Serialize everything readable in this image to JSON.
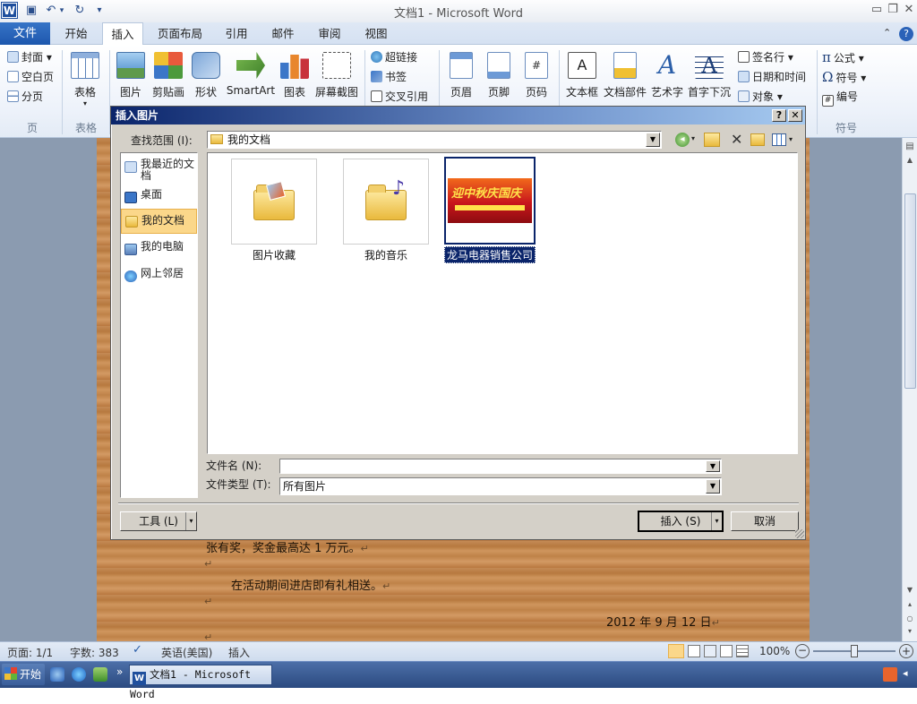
{
  "app": {
    "title": "文档1 - Microsoft Word",
    "logo": "W"
  },
  "qat": {
    "save_icon": "save-icon",
    "undo": "↶",
    "redo": "↻",
    "customize": "▾"
  },
  "window_controls": {
    "minimize": "▭",
    "restore": "❐",
    "close": "✕"
  },
  "tabs": {
    "file": "文件",
    "home": "开始",
    "insert": "插入",
    "layout": "页面布局",
    "references": "引用",
    "mailings": "邮件",
    "review": "审阅",
    "view": "视图"
  },
  "ribbon": {
    "pages": {
      "cover": "封面",
      "blank": "空白页",
      "break": "分页",
      "group": "页"
    },
    "tables": {
      "table": "表格",
      "group": "表格"
    },
    "illustrations": {
      "picture": "图片",
      "clipart": "剪贴画",
      "shapes": "形状",
      "smartart": "SmartArt",
      "chart": "图表",
      "screenshot": "屏幕截图"
    },
    "links": {
      "hyperlink": "超链接",
      "bookmark": "书签",
      "crossref": "交叉引用"
    },
    "header": {
      "header": "页眉",
      "footer": "页脚",
      "pagenum": "页码"
    },
    "text": {
      "textbox": "文本框",
      "quickparts": "文档部件",
      "wordart": "艺术字",
      "dropcap": "首字下沉",
      "signature": "签名行",
      "datetime": "日期和时间",
      "object": "对象"
    },
    "symbols": {
      "equation": "公式",
      "symbol": "符号",
      "number": "编号",
      "group": "符号"
    }
  },
  "document": {
    "line1": "张有奖，奖金最高达 1 万元。",
    "line2": "在活动期间进店即有礼相送。",
    "line3": "2012 年 9 月 12 日",
    "mark": "↵"
  },
  "dialog": {
    "title": "插入图片",
    "help": "?",
    "close": "✕",
    "lookin_label": "查找范围 (I):",
    "lookin_value": "我的文档",
    "places": [
      "我最近的文档",
      "桌面",
      "我的文档",
      "我的电脑",
      "网上邻居"
    ],
    "files": [
      {
        "name": "图片收藏",
        "type": "folder"
      },
      {
        "name": "我的音乐",
        "type": "folder"
      },
      {
        "name": "龙马电器销售公司",
        "type": "image"
      }
    ],
    "filename_label": "文件名 (N):",
    "filename_value": "",
    "filetype_label": "文件类型 (T):",
    "filetype_value": "所有图片",
    "tools": "工具 (L)",
    "insert": "插入 (S)",
    "cancel": "取消",
    "banner_text": "迎中秋庆国庆"
  },
  "status": {
    "page": "页面: 1/1",
    "words": "字数: 383",
    "lang": "英语(美国)",
    "mode": "插入",
    "zoom": "100%"
  },
  "taskbar": {
    "start": "开始",
    "window": "文档1 - Microsoft Word"
  },
  "colors": {
    "accent": "#1d57ad",
    "dialog_title": "#0a246a",
    "selected_place": "#fbd78a"
  }
}
